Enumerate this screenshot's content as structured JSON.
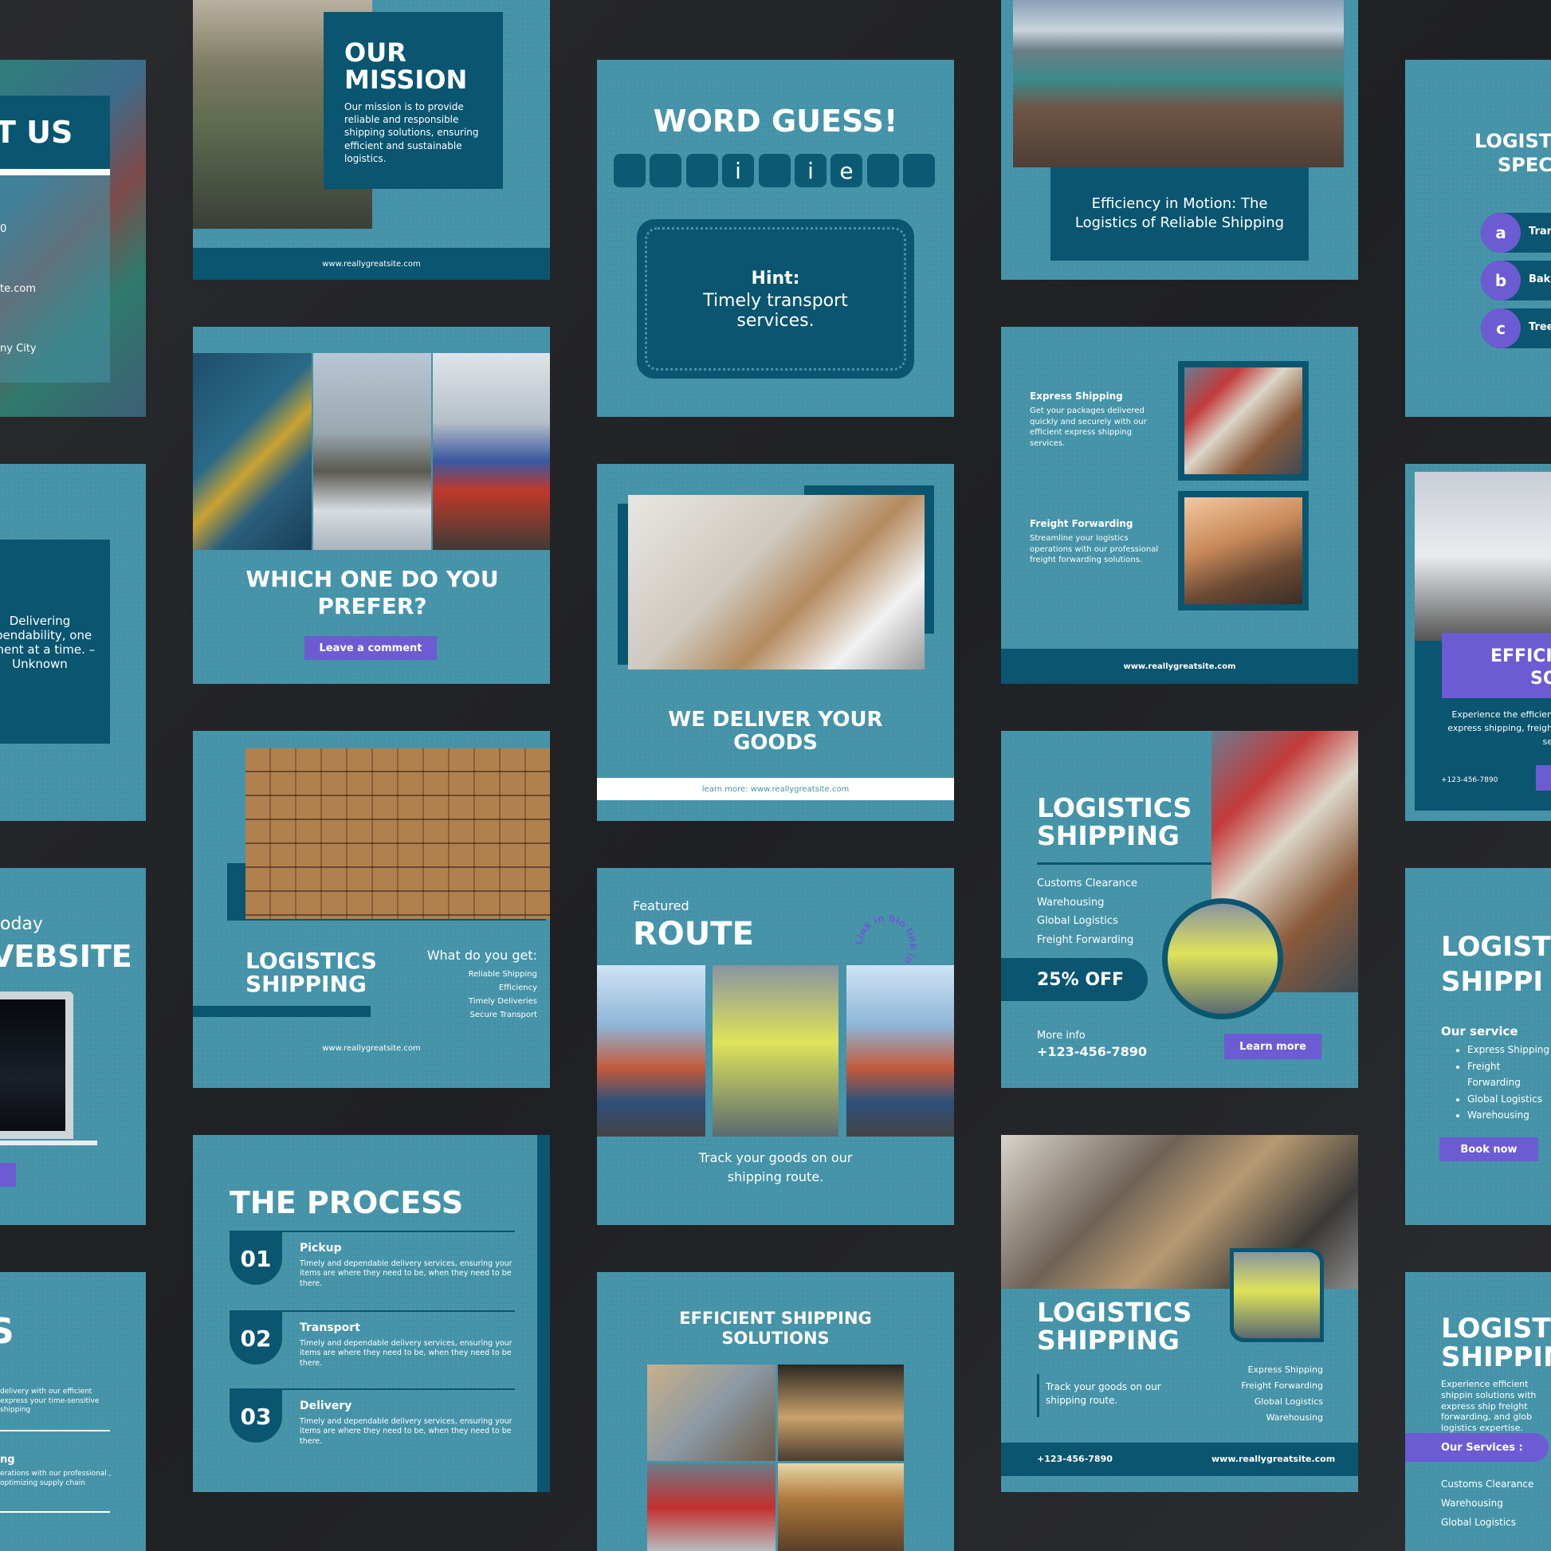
{
  "cards": {
    "about": {
      "title": "T US",
      "email_tail": "te.com",
      "addr_tail": "ny City",
      "num_tail": "0"
    },
    "mission": {
      "title": "OUR MISSION",
      "body": "Our mission is to provide reliable and responsible shipping solutions, ensuring efficient and sustainable logistics.",
      "site": "www.reallygreatsite.com"
    },
    "word_guess": {
      "title": "WORD GUESS!",
      "tiles": [
        "",
        "",
        "",
        "i",
        "",
        "i",
        "e",
        "",
        ""
      ],
      "hint_label": "Hint:",
      "hint_text": "Timely transport services."
    },
    "efficiency": {
      "caption": "Efficiency in Motion: The Logistics of Reliable Shipping"
    },
    "specs": {
      "title_l1": "LOGIST",
      "title_l2": "SPECI",
      "options": [
        {
          "letter": "a",
          "text": "Tran"
        },
        {
          "letter": "b",
          "text": "Baki"
        },
        {
          "letter": "c",
          "text": "Tree"
        }
      ]
    },
    "quote": {
      "text": "Delivering ependability, one pment at a time. – Unknown"
    },
    "prefer": {
      "title": "WHICH ONE DO YOU PREFER?",
      "button": "Leave a comment"
    },
    "deliver": {
      "title": "WE DELIVER YOUR GOODS",
      "footer": "learn more: www.reallygreatsite.com"
    },
    "services": {
      "items": [
        {
          "title": "Express Shipping",
          "body": "Get your packages delivered quickly and securely with our efficient express shipping services."
        },
        {
          "title": "Freight Forwarding",
          "body": "Streamline your logistics operations with our professional freight forwarding solutions."
        }
      ],
      "site": "www.reallygreatsite.com"
    },
    "efficient_right": {
      "title_l1": "EFFICIE",
      "title_l2": "SO",
      "body": "Experience the efficien express shipping, freigh se",
      "phone": "+123-456-7890"
    },
    "website": {
      "pre": "oday",
      "title": "VEBSITE"
    },
    "logistics_boxes": {
      "title": "LOGISTICS SHIPPING",
      "get_label": "What do you get:",
      "items": [
        "Reliable Shipping",
        "Efficiency",
        "Timely Deliveries",
        "Secure Transport"
      ],
      "site": "www.reallygreatsite.com"
    },
    "route": {
      "pre": "Featured",
      "title": "ROUTE",
      "circle_text": "Link in bio link in bio",
      "caption": "Track your goods on our shipping route."
    },
    "logistics_offer": {
      "title": "LOGISTICS SHIPPING",
      "items": [
        "Customs Clearance",
        "Warehousing",
        "Global Logistics",
        "Freight Forwarding"
      ],
      "offer": "25% OFF",
      "more_label": "More info",
      "phone": "+123-456-7890",
      "button": "Learn more"
    },
    "logistics_right": {
      "title_l1": "LOGIST",
      "title_l2": "SHIPPI",
      "service_label": "Our service",
      "items": [
        "Express Shipping",
        "Freight Forwarding",
        "Global Logistics",
        "Warehousing"
      ],
      "button": "Book now"
    },
    "left_bottom": {
      "big": "S",
      "p1": "delivery with our efficient express your time-sensitive shipping",
      "h2": "ng",
      "p2": "erations with our professional , optimizing supply chain"
    },
    "process": {
      "title": "THE PROCESS",
      "steps": [
        {
          "num": "01",
          "title": "Pickup",
          "body": "Timely and dependable delivery services, ensuring your items are where they need to be, when they need to be there."
        },
        {
          "num": "02",
          "title": "Transport",
          "body": "Timely and dependable delivery services, ensuring your items are where they need to be, when they need to be there."
        },
        {
          "num": "03",
          "title": "Delivery",
          "body": "Timely and dependable delivery services, ensuring your items are where they need to be, when they need to be there."
        }
      ]
    },
    "efficient_solutions": {
      "title": "EFFICIENT SHIPPING SOLUTIONS"
    },
    "logistics_men": {
      "title": "LOGISTICS SHIPPING",
      "caption": "Track your goods on our shipping route.",
      "items": [
        "Express Shipping",
        "Freight Forwarding",
        "Global Logistics",
        "Warehousing"
      ],
      "phone": "+123-456-7890",
      "site": "www.reallygreatsite.com"
    },
    "logistics_bottom_right": {
      "title_l1": "LOGISTI",
      "title_l2": "SHIPPIN",
      "body": "Experience efficient shippin solutions with express ship freight forwarding, and glob logistics expertise.",
      "services_label": "Our Services :",
      "items": [
        "Customs Clearance",
        "Warehousing",
        "Global Logistics"
      ]
    }
  }
}
